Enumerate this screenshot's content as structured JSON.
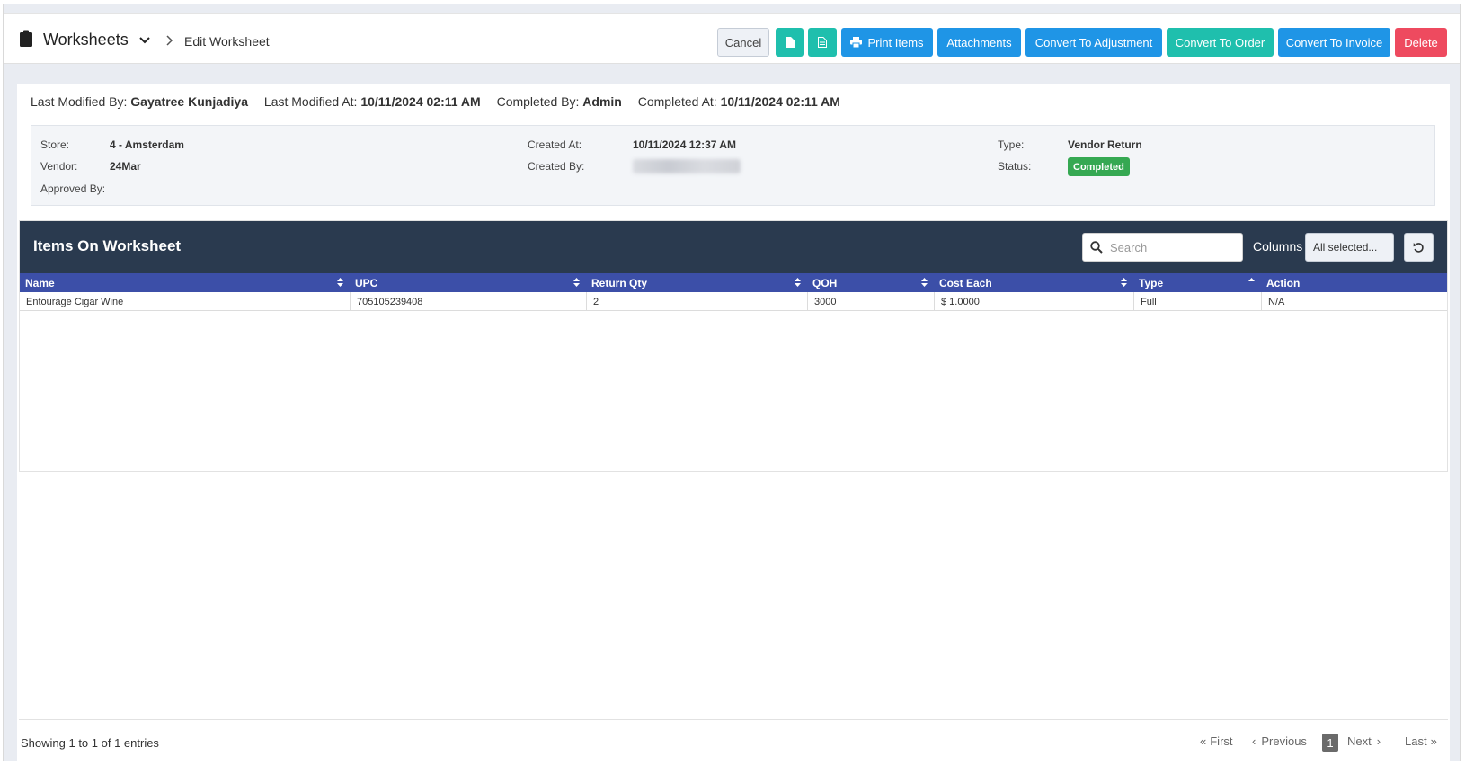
{
  "header": {
    "title": "Worksheets",
    "breadcrumb": "Edit Worksheet",
    "buttons": {
      "cancel": "Cancel",
      "print": "Print Items",
      "attachments": "Attachments",
      "convert_adjustment": "Convert To Adjustment",
      "convert_order": "Convert To Order",
      "convert_invoice": "Convert To Invoice",
      "delete": "Delete"
    }
  },
  "meta": {
    "modified_by_label": "Last Modified By:",
    "modified_by": "Gayatree Kunjadiya",
    "modified_at_label": "Last Modified At:",
    "modified_at": "10/11/2024 02:11 AM",
    "completed_by_label": "Completed By:",
    "completed_by": "Admin",
    "completed_at_label": "Completed At:",
    "completed_at": "10/11/2024 02:11 AM"
  },
  "info": {
    "store_label": "Store:",
    "store": "4 - Amsterdam",
    "vendor_label": "Vendor:",
    "vendor": "24Mar",
    "approved_by_label": "Approved By:",
    "created_at_label": "Created At:",
    "created_at": "10/11/2024 12:37 AM",
    "created_by_label": "Created By:",
    "type_label": "Type:",
    "type": "Vendor Return",
    "status_label": "Status:",
    "status": "Completed",
    "status_color": "#35a852"
  },
  "table": {
    "title": "Items On Worksheet",
    "search_placeholder": "Search",
    "columns_label": "Columns",
    "columns_value": "All selected...",
    "headers": [
      "Name",
      "UPC",
      "Return Qty",
      "QOH",
      "Cost Each",
      "Type",
      "Action"
    ],
    "rows": [
      [
        "Entourage Cigar Wine",
        "705105239408",
        "2",
        "3000",
        "$ 1.0000",
        "Full",
        "N/A"
      ]
    ]
  },
  "footer": {
    "showing": "Showing 1 to 1 of 1 entries",
    "first": "First",
    "previous": "Previous",
    "page": "1",
    "next": "Next",
    "last": "Last"
  },
  "colors": {
    "teal": "#1fbfad",
    "blue": "#1f95e6",
    "red": "#ee4a5f",
    "table_header": "#3c4fa8",
    "card_header": "#2a3a4f"
  }
}
